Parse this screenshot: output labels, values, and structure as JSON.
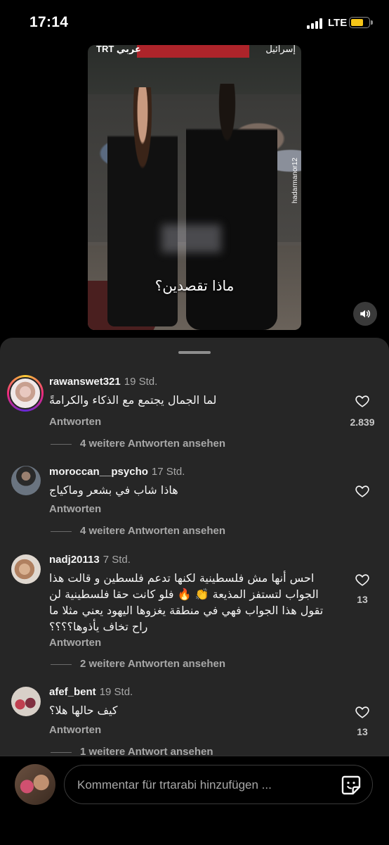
{
  "status": {
    "time": "17:14",
    "network": "LTE"
  },
  "video": {
    "logo_left": "TRT عربي",
    "logo_right": "إسرائيل",
    "watermark": "hadarmanor12",
    "caption": "ماذا تقصدين؟"
  },
  "comments": [
    {
      "username": "rawanswet321",
      "age": "19 Std.",
      "text": "لما الجمال يجتمع مع الذكاء والكرامةً",
      "reply": "Antworten",
      "likes": "2.839",
      "more": "4 weitere Antworten ansehen"
    },
    {
      "username": "moroccan__psycho",
      "age": "17 Std.",
      "text": "هاذا شاب في بشعر وماكياج",
      "reply": "Antworten",
      "likes": "",
      "more": "4 weitere Antworten ansehen"
    },
    {
      "username": "nadj20113",
      "age": "7 Std.",
      "text": "احس أنها مش فلسطينية لكنها تدعم فلسطين و قالت هذا الجواب لتستفز المذيعة 👏 🔥 فلو كانت حقا فلسطينية لن تقول هذا الجواب فهي في منطقة يغزوها اليهود يعني مثلا ما راح تخاف يأذوها؟؟؟؟",
      "reply": "Antworten",
      "likes": "13",
      "more": "2 weitere Antworten ansehen"
    },
    {
      "username": "afef_bent",
      "age": "19 Std.",
      "text": "كيف حالها هلا؟",
      "reply": "Antworten",
      "likes": "13",
      "more": "1 weitere Antwort ansehen"
    }
  ],
  "composer": {
    "placeholder": "Kommentar für trtarabi hinzufügen ..."
  }
}
